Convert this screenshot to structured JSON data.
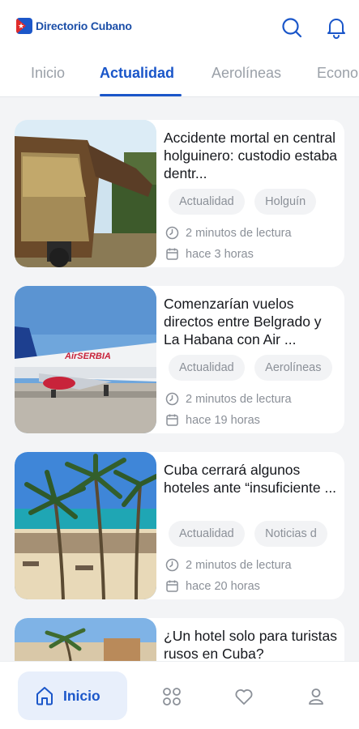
{
  "header": {
    "app_title": "Directorio Cubano",
    "search_icon": "search-icon",
    "bell_icon": "bell-icon"
  },
  "tabs": [
    {
      "label": "Inicio",
      "active": false
    },
    {
      "label": "Actualidad",
      "active": true
    },
    {
      "label": "Aerolíneas",
      "active": false
    },
    {
      "label": "Econo",
      "active": false
    }
  ],
  "articles": [
    {
      "title": "Accidente mortal en central holguinero: custodio estaba dentr...",
      "tags": [
        "Actualidad",
        "Holguín"
      ],
      "read_time": "2 minutos de lectura",
      "posted": "hace 3 horas",
      "image": "sugar-cane-truck"
    },
    {
      "title": "Comenzarían vuelos directos entre Belgrado y La Habana con Air ...",
      "tags": [
        "Actualidad",
        "Aerolíneas"
      ],
      "read_time": "2 minutos de lectura",
      "posted": "hace 19 horas",
      "image": "airplane",
      "plane_livery": "AirSERBIA"
    },
    {
      "title": "Cuba cerrará algunos hoteles ante “insuficiente ...",
      "tags": [
        "Actualidad",
        "Noticias d"
      ],
      "read_time": "2 minutos de lectura",
      "posted": "hace 20 horas",
      "image": "beach-palms"
    },
    {
      "title": "¿Un hotel solo para turistas rusos en Cuba?",
      "tags": [],
      "read_time": "",
      "posted": "",
      "image": "hotel-palms"
    }
  ],
  "bottom_nav": {
    "home_label": "Inicio",
    "items": [
      "home-icon",
      "grid-icon",
      "heart-icon",
      "user-icon"
    ]
  },
  "colors": {
    "accent": "#1a56c9",
    "muted_text": "#8b9098",
    "tag_bg": "#f2f3f5"
  }
}
